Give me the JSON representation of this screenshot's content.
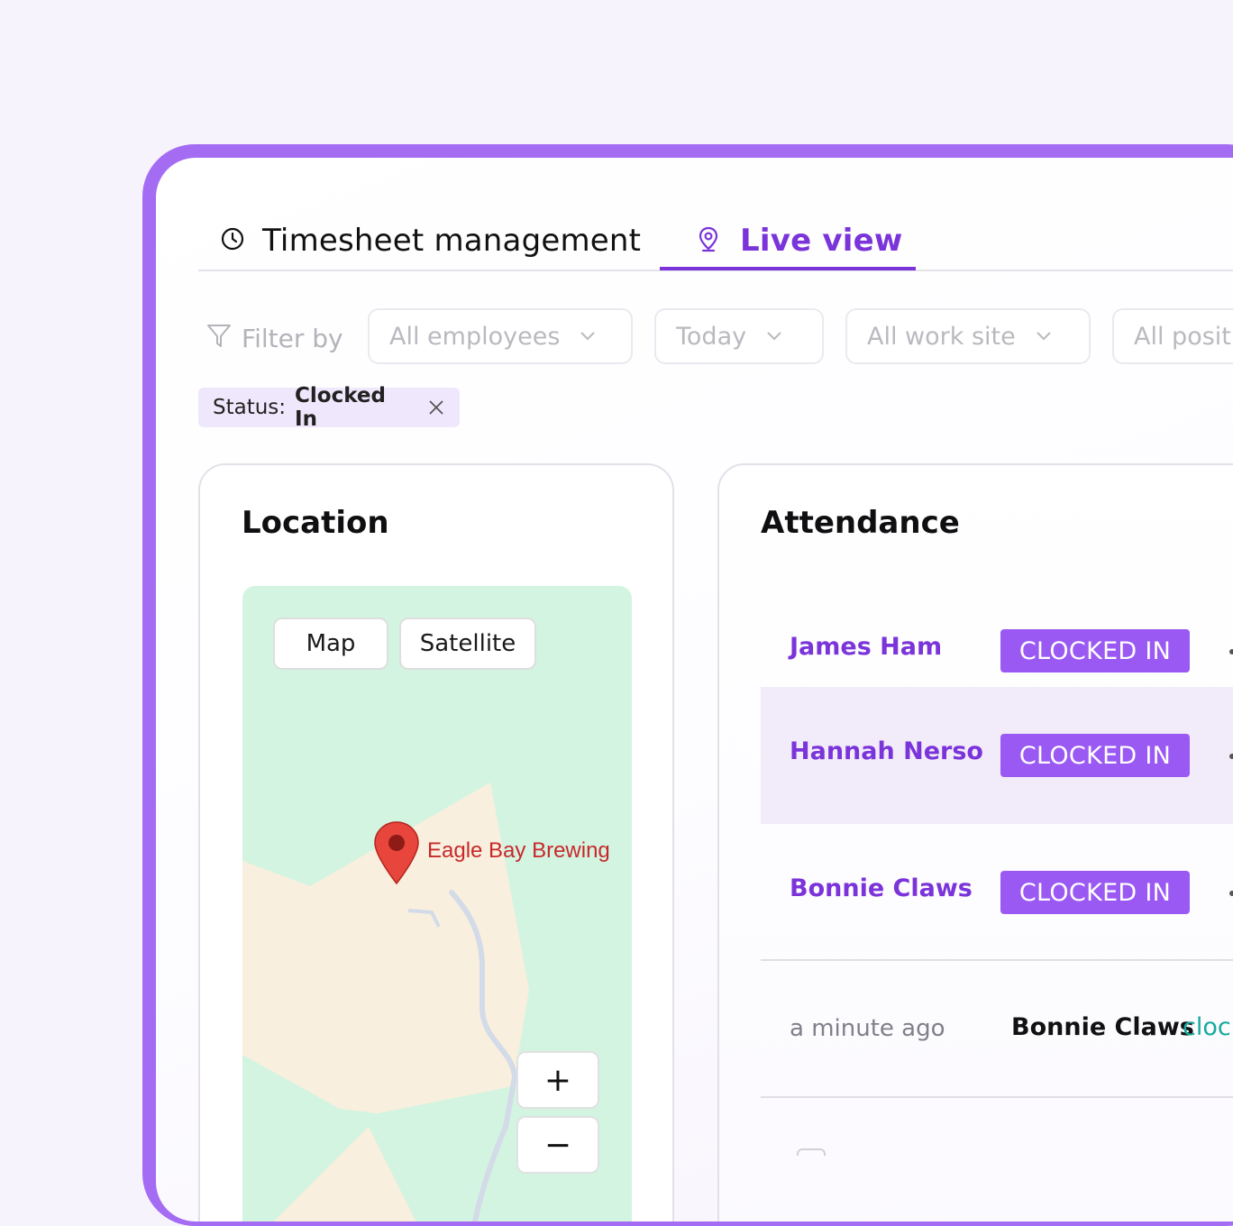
{
  "tabs": {
    "timesheet": {
      "label": "Timesheet management",
      "icon": "clock-icon"
    },
    "live": {
      "label": "Live view",
      "icon": "location-pin-icon",
      "active": true
    }
  },
  "filters": {
    "label": "Filter by",
    "dropdowns": [
      {
        "label": "All employees"
      },
      {
        "label": "Today"
      },
      {
        "label": "All work site"
      },
      {
        "label": "All posit"
      }
    ]
  },
  "active_filter": {
    "key": "Status:",
    "value": "Clocked In"
  },
  "location_card": {
    "title": "Location",
    "map": {
      "type_buttons": [
        "Map",
        "Satellite"
      ],
      "place": "Eagle Bay Brewing",
      "zoom_in": "+",
      "zoom_out": "−"
    }
  },
  "attendance_card": {
    "title": "Attendance",
    "rows": [
      {
        "name": "James Ham",
        "status": "CLOCKED IN"
      },
      {
        "name": "Hannah Nerso",
        "status": "CLOCKED IN"
      },
      {
        "name": "Bonnie Claws",
        "status": "CLOCKED IN"
      }
    ],
    "activity": [
      {
        "time": "a minute ago",
        "who": "Bonnie Claws",
        "what": "cloc"
      }
    ]
  },
  "colors": {
    "accent": "#7a34d9",
    "badge": "#9b59f4",
    "frame": "#a46cf2",
    "map_land": "#d3f4e1",
    "map_area": "#f9efde",
    "place_label": "#c8282a",
    "activity_action": "#17a9a0"
  }
}
